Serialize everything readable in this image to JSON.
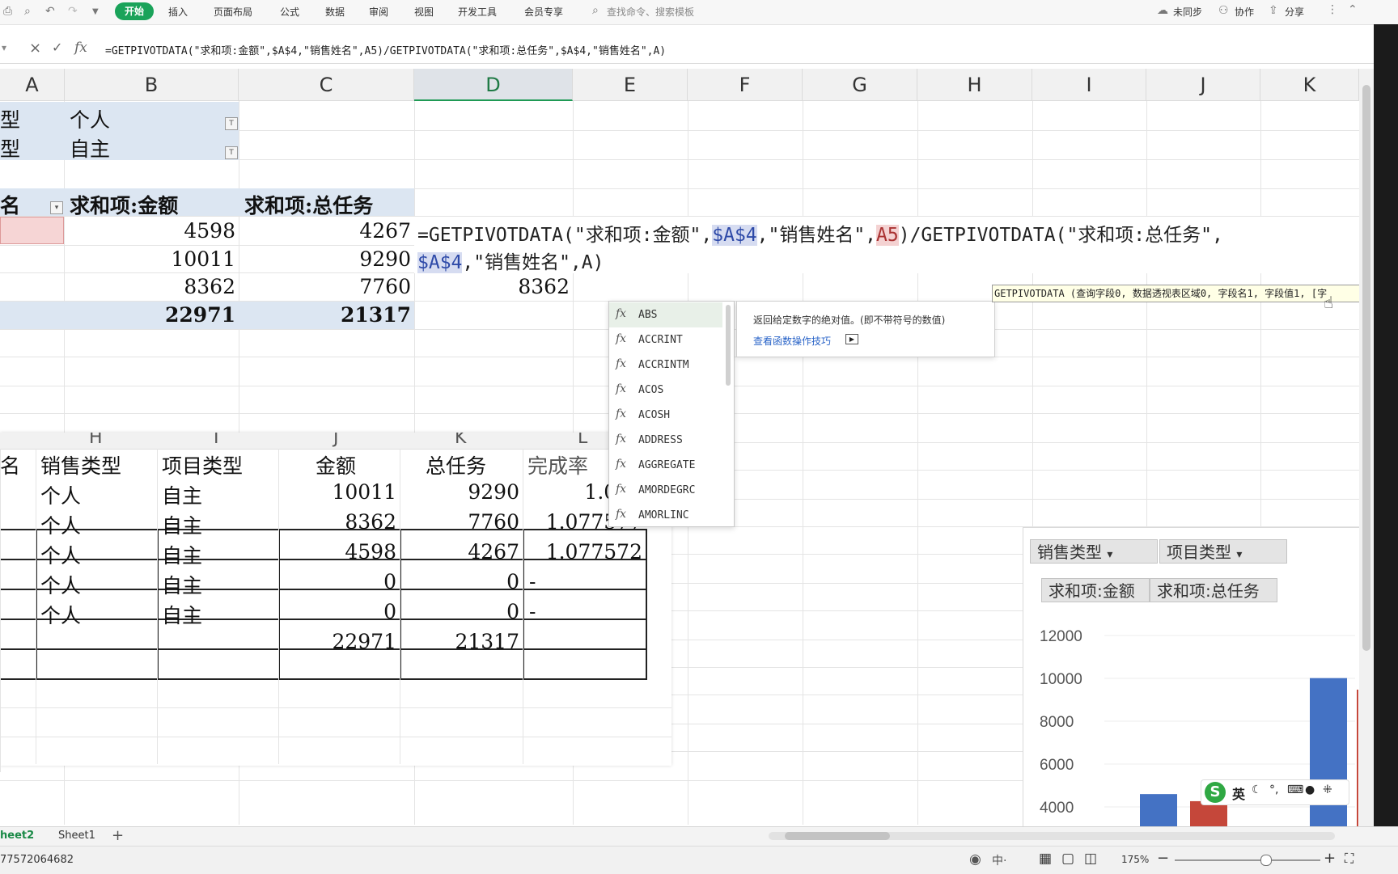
{
  "menubar": {
    "start": "开始",
    "items": [
      "插入",
      "页面布局",
      "公式",
      "数据",
      "审阅",
      "视图",
      "开发工具",
      "会员专享"
    ],
    "search": "查找命令、搜索模板",
    "sync": "未同步",
    "collab": "协作",
    "share": "分享"
  },
  "formula_bar": {
    "cancel": "×",
    "confirm": "✓",
    "fx": "fx",
    "formula": "=GETPIVOTDATA(\"求和项:金额\",$A$4,\"销售姓名\",A5)/GETPIVOTDATA(\"求和项:总任务\",$A$4,\"销售姓名\",A)"
  },
  "columns": [
    "A",
    "B",
    "C",
    "D",
    "E",
    "F",
    "G",
    "H",
    "I",
    "J",
    "K"
  ],
  "pivot": {
    "filter1_label": "型",
    "filter1_value": "个人",
    "filter2_label": "型",
    "filter2_value": "自主",
    "row_header": "名",
    "col1_header": "求和项:金额",
    "col2_header": "求和项:总任务",
    "rows": [
      {
        "amount": "4598",
        "task": "4267"
      },
      {
        "amount": "10011",
        "task": "9290"
      },
      {
        "amount": "8362",
        "task": "7760"
      }
    ],
    "total_amount": "22971",
    "total_task": "21317"
  },
  "editing_cell": {
    "line1_prefix": "=GETPIVOTDATA(\"求和项:金额\",",
    "ref1": "$A$4",
    "mid1": ",\"销售姓名\",",
    "ref2": "A5",
    "mid2": ")/GETPIVOTDATA(\"求和项:总任务\",",
    "ref3": "$A$4",
    "line2_rest": ",\"销售姓名\",A)",
    "below_value": "8362"
  },
  "tooltip": "GETPIVOTDATA (查询字段0, 数据透视表区域0, 字段名1, 字段值1, [字",
  "autocomplete": {
    "items": [
      "ABS",
      "ACCRINT",
      "ACCRINTM",
      "ACOS",
      "ACOSH",
      "ADDRESS",
      "AGGREGATE",
      "AMORDEGRC",
      "AMORLINC"
    ],
    "fx": "fx",
    "description": "返回给定数字的绝对值。(即不带符号的数值)",
    "link": "查看函数操作技巧"
  },
  "lower_table": {
    "col_labels": [
      "H",
      "I",
      "J",
      "K",
      "L"
    ],
    "headers": [
      "名",
      "销售类型",
      "项目类型",
      "金额",
      "总任务",
      "完成率"
    ],
    "rows": [
      [
        "个人",
        "自主",
        "10011",
        "9290",
        "1.077"
      ],
      [
        "个人",
        "自主",
        "8362",
        "7760",
        "1.077577"
      ],
      [
        "个人",
        "自主",
        "4598",
        "4267",
        "1.077572"
      ],
      [
        "个人",
        "自主",
        "0",
        "0",
        "-"
      ],
      [
        "个人",
        "自主",
        "0",
        "0",
        "-"
      ]
    ],
    "total_amount": "22971",
    "total_task": "21317"
  },
  "chart_data": {
    "type": "bar",
    "filter_chips": [
      "销售类型",
      "项目类型"
    ],
    "series": [
      {
        "name": "求和项:金额",
        "color": "#4472c4",
        "values": [
          4598,
          10011
        ]
      },
      {
        "name": "求和项:总任务",
        "color": "#c5473a",
        "values": [
          4267
        ]
      }
    ],
    "yticks": [
      "12000",
      "10000",
      "8000",
      "6000",
      "4000"
    ],
    "ylim": [
      4000,
      12000
    ]
  },
  "ime": {
    "lang": "英"
  },
  "sheet_tabs": [
    "heet2",
    "Sheet1"
  ],
  "add_sheet": "+",
  "status": {
    "value": "77572064682",
    "zoom": "175%"
  }
}
